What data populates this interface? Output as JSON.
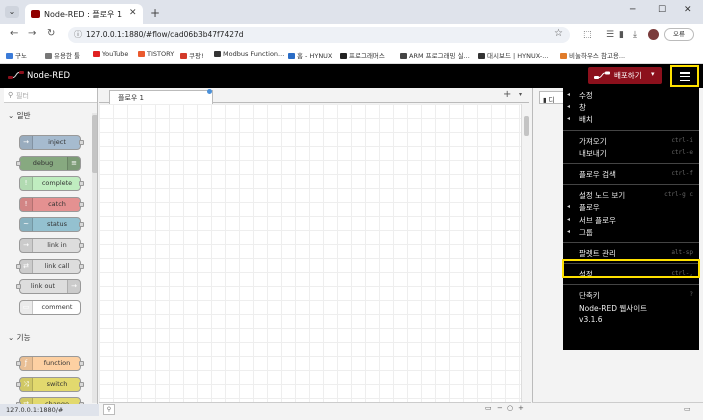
{
  "browser": {
    "tab_title": "Node-RED : 플로우 1",
    "url": "127.0.0.1:1880/#flow/cad06b3b47f7427d",
    "profile_label": "오류",
    "tab_close": "✕",
    "new_tab": "+",
    "window": {
      "minimize": "─",
      "maximize": "☐",
      "close": "✕"
    },
    "bookmarks": [
      {
        "label": "구노",
        "color": "#3b7bd8"
      },
      {
        "label": "유용한 툴",
        "color": "#777777"
      },
      {
        "label": "YouTube",
        "color": "#e02020"
      },
      {
        "label": "TISTORY",
        "color": "#ea5a2e"
      },
      {
        "label": "쿠팡!",
        "color": "#d33a2a"
      },
      {
        "label": "Modbus Function...",
        "color": "#333333"
      },
      {
        "label": "홈 - HYNUX",
        "color": "#2a6cc5"
      },
      {
        "label": "프로그래머스",
        "color": "#222222"
      },
      {
        "label": "ARM 프로그래밍 실...",
        "color": "#444444"
      },
      {
        "label": "대시보드 | HYNUX-...",
        "color": "#333333"
      },
      {
        "label": "비눌하우스 참고용...",
        "color": "#e07b2a"
      }
    ]
  },
  "app": {
    "title": "Node-RED",
    "deploy_label": "배포하기",
    "palette_filter_placeholder": "필터",
    "categories": [
      "일반",
      "기능"
    ],
    "nodes_common": [
      {
        "label": "inject",
        "color": "#a6bbcf",
        "icon_side": "left",
        "icon": "→"
      },
      {
        "label": "debug",
        "color": "#87a980",
        "icon_side": "right",
        "icon": "≡"
      },
      {
        "label": "complete",
        "color": "#c0edc0",
        "icon_side": "left",
        "icon": "!"
      },
      {
        "label": "catch",
        "color": "#e49191",
        "icon_side": "left",
        "icon": "!"
      },
      {
        "label": "status",
        "color": "#94c1d0",
        "icon_side": "left",
        "icon": "~"
      },
      {
        "label": "link in",
        "color": "#dddddd",
        "icon_side": "left",
        "icon": "→"
      },
      {
        "label": "link call",
        "color": "#dddddd",
        "icon_side": "left",
        "icon": "⇄"
      },
      {
        "label": "link out",
        "color": "#dddddd",
        "icon_side": "right",
        "icon": "→"
      },
      {
        "label": "comment",
        "color": "#ffffff",
        "icon_side": "left",
        "icon": "▭"
      }
    ],
    "nodes_function": [
      {
        "label": "function",
        "color": "#fdd0a2",
        "icon_side": "left",
        "icon": "ƒ"
      },
      {
        "label": "switch",
        "color": "#e2d96e",
        "icon_side": "left",
        "icon": "⤨"
      },
      {
        "label": "change",
        "color": "#e2d96e",
        "icon_side": "left",
        "icon": "⇄"
      }
    ],
    "workspace_tab": "플로우 1",
    "status_url": "127.0.0.1:1880/#",
    "sidebar_tab": "디",
    "zoom_controls": [
      "▭",
      "−",
      "○",
      "+"
    ]
  },
  "menu": {
    "items": [
      {
        "label": "수정",
        "caret": true,
        "shortcut": ""
      },
      {
        "label": "창",
        "caret": true,
        "shortcut": ""
      },
      {
        "label": "배치",
        "caret": true,
        "shortcut": ""
      },
      {
        "sep": true
      },
      {
        "label": "가져오기",
        "caret": false,
        "shortcut": "ctrl-i"
      },
      {
        "label": "내보내기",
        "caret": false,
        "shortcut": "ctrl-e"
      },
      {
        "sep": true
      },
      {
        "label": "플로우 검색",
        "caret": false,
        "shortcut": "ctrl-f"
      },
      {
        "sep": true
      },
      {
        "label": "설정 노드 보기",
        "caret": false,
        "shortcut": "ctrl-g c"
      },
      {
        "label": "플로우",
        "caret": true,
        "shortcut": ""
      },
      {
        "label": "서브 플로우",
        "caret": true,
        "shortcut": ""
      },
      {
        "label": "그룹",
        "caret": true,
        "shortcut": ""
      },
      {
        "sep": true
      },
      {
        "label": "팔렛트 관리",
        "caret": false,
        "shortcut": "alt-sp",
        "highlight": true
      },
      {
        "sep": true
      },
      {
        "label": "설정",
        "caret": false,
        "shortcut": "ctrl-,"
      },
      {
        "sep": true
      },
      {
        "label": "단축키",
        "caret": false,
        "shortcut": "?"
      },
      {
        "label": "Node-RED 웹사이트",
        "caret": false,
        "shortcut": ""
      },
      {
        "label": "v3.1.6",
        "caret": false,
        "shortcut": ""
      }
    ]
  }
}
